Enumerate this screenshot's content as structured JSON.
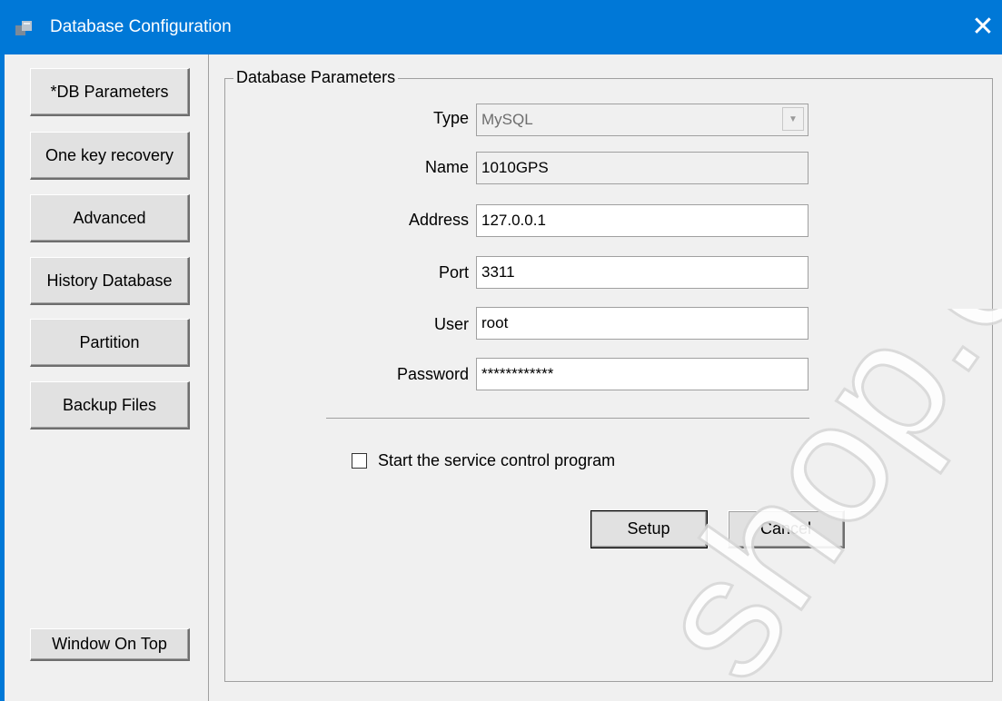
{
  "window": {
    "title": "Database Configuration"
  },
  "sidebar": {
    "items": [
      {
        "label": "*DB Parameters"
      },
      {
        "label": "One key recovery"
      },
      {
        "label": "Advanced"
      },
      {
        "label": "History Database"
      },
      {
        "label": "Partition"
      },
      {
        "label": "Backup Files"
      }
    ],
    "window_on_top": "Window On Top"
  },
  "group": {
    "title": "Database Parameters"
  },
  "form": {
    "type": {
      "label": "Type",
      "value": "MySQL"
    },
    "name": {
      "label": "Name",
      "value": "1010GPS"
    },
    "address": {
      "label": "Address",
      "value": "127.0.0.1"
    },
    "port": {
      "label": "Port",
      "value": "3311"
    },
    "user": {
      "label": "User",
      "value": "root"
    },
    "password": {
      "label": "Password",
      "value": "************"
    }
  },
  "options": {
    "start_service_label": "Start the service control program",
    "start_service_checked": false
  },
  "buttons": {
    "setup": "Setup",
    "cancel": "Cancel"
  },
  "watermark": {
    "text": "shop.co"
  }
}
